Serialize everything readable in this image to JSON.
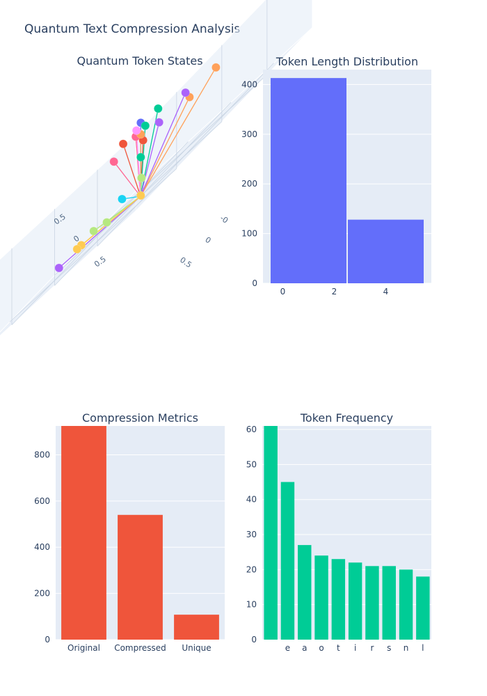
{
  "title": "Quantum Text Compression Analysis",
  "colors": {
    "plot_bg": "#E5ECF6",
    "grid": "#FFFFFF",
    "text": "#2a3f5f",
    "hist_bar": "#636EFA",
    "metric_bar": "#EF553B",
    "freq_bar": "#00CC96",
    "palette": [
      "#636EFA",
      "#EF553B",
      "#00CC96",
      "#AB63FA",
      "#FFA15A",
      "#19D3F3",
      "#FF6692",
      "#B6E880",
      "#FF97FF",
      "#FECB52"
    ]
  },
  "chart_data": [
    {
      "type": "scatter3d",
      "title": "Quantum Token States",
      "axis_tick_labels": [
        "0.5",
        "0",
        "0.5",
        "-0",
        "0",
        "0.5"
      ],
      "points": [
        {
          "x": 0.05,
          "y": 0.05,
          "z": 0.95,
          "color": "#636EFA"
        },
        {
          "x": -0.05,
          "y": 0.15,
          "z": 0.9,
          "color": "#EF553B"
        },
        {
          "x": 0.1,
          "y": -0.1,
          "z": 0.92,
          "color": "#00CC96"
        },
        {
          "x": 0.45,
          "y": -0.05,
          "z": 0.75,
          "color": "#AB63FA"
        },
        {
          "x": 0.55,
          "y": -0.3,
          "z": 0.7,
          "color": "#FFA15A"
        },
        {
          "x": 0.6,
          "y": 0.85,
          "z": 0.1,
          "color": "#19D3F3"
        },
        {
          "x": -0.1,
          "y": -0.05,
          "z": 0.85,
          "color": "#FF6692"
        },
        {
          "x": 0.2,
          "y": 0.2,
          "z": 0.2,
          "color": "#B6E880"
        },
        {
          "x": 0.05,
          "y": 0.1,
          "z": 0.9,
          "color": "#FF97FF"
        },
        {
          "x": 0.15,
          "y": 0.85,
          "z": 0.05,
          "color": "#FECB52"
        },
        {
          "x": -0.2,
          "y": 0.1,
          "z": 0.8,
          "color": "#FF6692"
        },
        {
          "x": -0.35,
          "y": -0.4,
          "z": 0.75,
          "color": "#EF553B"
        },
        {
          "x": 0.1,
          "y": 0.05,
          "z": 0.85,
          "color": "#00CC96"
        },
        {
          "x": 0.05,
          "y": 0.05,
          "z": 0.5,
          "color": "#00CC96"
        },
        {
          "x": 0.4,
          "y": -0.15,
          "z": 0.65,
          "color": "#FFA15A"
        },
        {
          "x": 0.3,
          "y": 0.1,
          "z": 0.7,
          "color": "#AB63FA"
        },
        {
          "x": 0.05,
          "y": 0.6,
          "z": 0.1,
          "color": "#B6E880"
        },
        {
          "x": 0.1,
          "y": 0.5,
          "z": 0.05,
          "color": "#B6E880"
        },
        {
          "x": -0.05,
          "y": 0.9,
          "z": 0.05,
          "color": "#AB63FA"
        },
        {
          "x": 0.15,
          "y": 0.9,
          "z": 0.05,
          "color": "#FECB52"
        },
        {
          "x": 0.05,
          "y": 0.05,
          "z": 0.8,
          "color": "#FFA15A"
        },
        {
          "x": 0.05,
          "y": 0.05,
          "z": 0.0,
          "color": "#FECB52"
        }
      ]
    },
    {
      "type": "bar",
      "title": "Token Length Distribution",
      "bins": [
        {
          "x0": -0.5,
          "x1": 2.5,
          "value": 413
        },
        {
          "x0": 2.5,
          "x1": 5.5,
          "value": 128
        }
      ],
      "xlim": [
        -0.5,
        5.5
      ],
      "xticks": [
        0,
        2,
        4
      ],
      "ylim": [
        0,
        430
      ],
      "yticks": [
        0,
        100,
        200,
        300,
        400
      ]
    },
    {
      "type": "bar",
      "title": "Compression Metrics",
      "categories": [
        "Original",
        "Compressed",
        "Unique"
      ],
      "values": [
        925,
        540,
        108
      ],
      "ylim": [
        0,
        925
      ],
      "yticks": [
        0,
        200,
        400,
        600,
        800
      ]
    },
    {
      "type": "bar",
      "title": "Token Frequency",
      "categories": [
        " ",
        "e",
        "a",
        "o",
        "t",
        "i",
        "r",
        "s",
        "n",
        "l"
      ],
      "values": [
        61,
        45,
        27,
        24,
        23,
        22,
        21,
        21,
        20,
        18
      ],
      "ylim": [
        0,
        61
      ],
      "yticks": [
        0,
        10,
        20,
        30,
        40,
        50,
        60
      ]
    }
  ]
}
